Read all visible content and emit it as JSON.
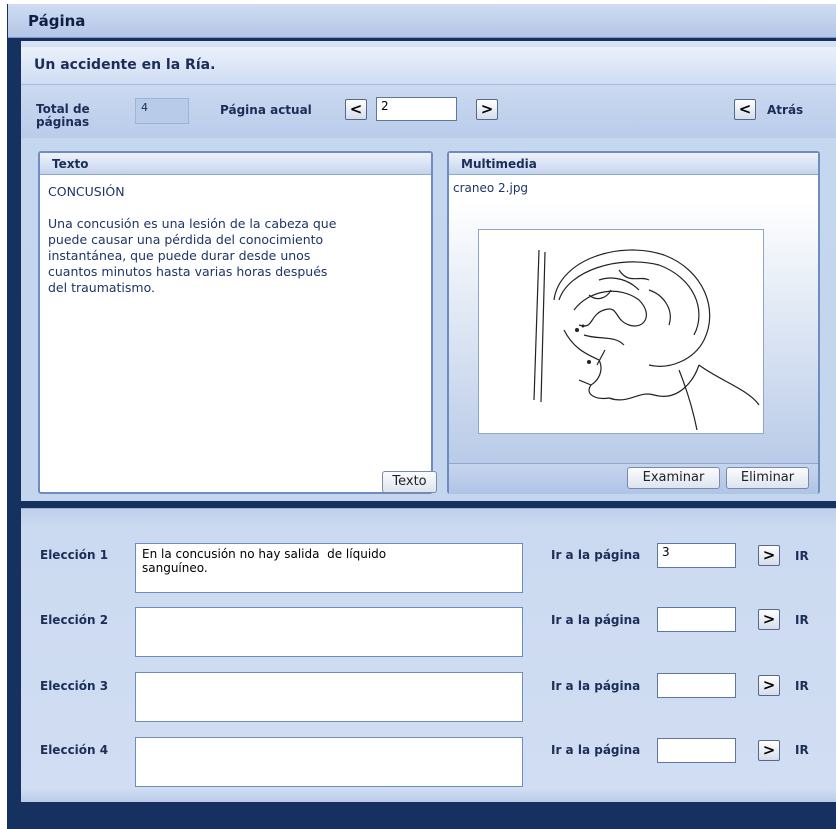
{
  "window": {
    "title": "Página"
  },
  "header": {
    "title": "Un accidente en la Ría."
  },
  "nav": {
    "total_label_line1": "Total de",
    "total_label_line2": "páginas",
    "total_value": "4",
    "current_label": "Página actual",
    "prev_symbol": "<",
    "next_symbol": ">",
    "current_value": "2",
    "back_symbol": "<",
    "back_label": "Atrás"
  },
  "texto": {
    "header": "Texto",
    "content": "CONCUSIÓN\n\nUna concusión es una lesión de la cabeza que\npuede causar una pérdida del conocimiento\ninstantánea, que puede durar desde unos\ncuantos minutos hasta varias horas después\ndel traumatismo.",
    "button_label": "Texto"
  },
  "multimedia": {
    "header": "Multimedia",
    "filename": "craneo 2.jpg",
    "image_icon": "skull-brain-sketch",
    "examine_label": "Examinar",
    "delete_label": "Eliminar"
  },
  "choices": [
    {
      "label": "Elección 1",
      "text": "En la concusión no hay salida  de líquido\nsanguíneo.",
      "goto_label": "Ir a la página",
      "goto_value": "3",
      "go_symbol": ">",
      "go_label": "IR"
    },
    {
      "label": "Elección 2",
      "text": "",
      "goto_label": "Ir a la página",
      "goto_value": "",
      "go_symbol": ">",
      "go_label": "IR"
    },
    {
      "label": "Elección 3",
      "text": "",
      "goto_label": "Ir a la página",
      "goto_value": "",
      "go_symbol": ">",
      "go_label": "IR"
    },
    {
      "label": "Elección 4",
      "text": "",
      "goto_label": "Ir a la página",
      "goto_value": "",
      "go_symbol": ">",
      "go_label": "IR"
    }
  ],
  "colors": {
    "frame": "#16315f",
    "panel": "#c5d6ef",
    "accent": "#6f8cc0"
  }
}
